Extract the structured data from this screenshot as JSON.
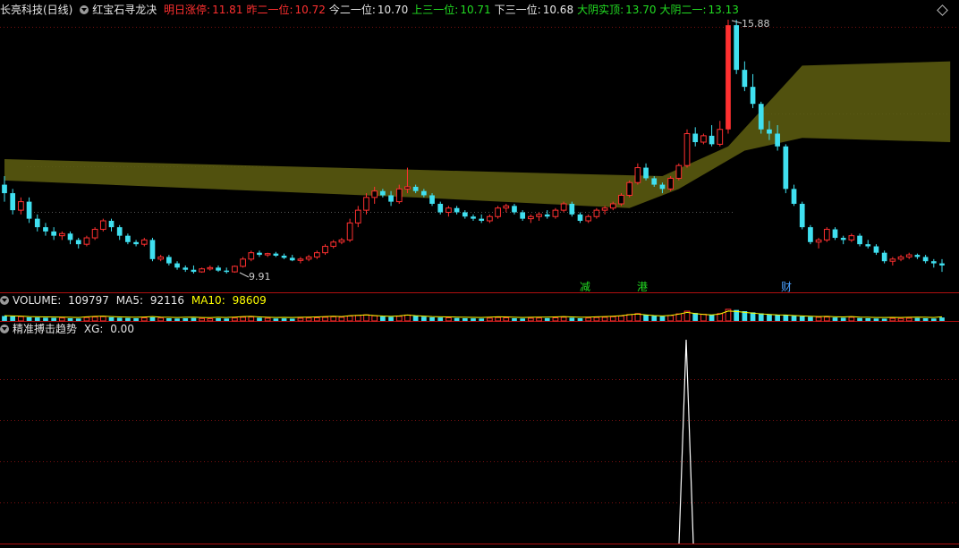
{
  "main_header": {
    "stock": "长亮科技(日线)",
    "indicator": "红宝石寻龙决",
    "items": [
      {
        "label": "明日涨停:",
        "value": "11.81",
        "color": "#ff3030",
        "vcolor": "#ff3030"
      },
      {
        "label": "昨二一位:",
        "value": "10.72",
        "color": "#ff3030",
        "vcolor": "#ff3030"
      },
      {
        "label": "今二一位:",
        "value": "10.70",
        "color": "#e6e6e6",
        "vcolor": "#e6e6e6"
      },
      {
        "label": "上三一位:",
        "value": "10.71",
        "color": "#22dd22",
        "vcolor": "#22dd22"
      },
      {
        "label": "下三一位:",
        "value": "10.68",
        "color": "#e6e6e6",
        "vcolor": "#e6e6e6"
      },
      {
        "label": "大阴实顶:",
        "value": "13.70",
        "color": "#22dd22",
        "vcolor": "#22dd22"
      },
      {
        "label": "大阴二一:",
        "value": "13.13",
        "color": "#22dd22",
        "vcolor": "#22dd22"
      }
    ]
  },
  "volume_header": {
    "label": "VOLUME:",
    "value": "109797",
    "ma5_label": "MA5:",
    "ma5": "92116",
    "ma10_label": "MA10:",
    "ma10": "98609"
  },
  "sub_header": {
    "label": "精准搏击趋势",
    "xg_label": "XG:",
    "xg": "0.00"
  },
  "annotations": {
    "high": "15.88",
    "low": "9.91"
  },
  "markers": [
    {
      "text": "减",
      "color": "#22dd22"
    },
    {
      "text": "港",
      "color": "#22dd22"
    },
    {
      "text": "财",
      "color": "#4aa0ff"
    }
  ],
  "colors": {
    "up": "#ff3030",
    "down": "#40e0f0",
    "band": "#5a5a10",
    "signal": "#ffffff"
  },
  "chart_data": {
    "type": "candlestick",
    "title": "红宝石寻龙决",
    "price_range": [
      9.91,
      15.88
    ],
    "candles": [
      [
        12.0,
        12.2,
        11.6,
        11.8
      ],
      [
        11.8,
        11.9,
        11.3,
        11.4
      ],
      [
        11.4,
        11.7,
        11.3,
        11.6
      ],
      [
        11.6,
        11.7,
        11.1,
        11.2
      ],
      [
        11.2,
        11.3,
        10.9,
        11.0
      ],
      [
        11.0,
        11.1,
        10.8,
        10.9
      ],
      [
        10.9,
        11.0,
        10.7,
        10.8
      ],
      [
        10.8,
        10.9,
        10.7,
        10.85
      ],
      [
        10.85,
        10.9,
        10.6,
        10.7
      ],
      [
        10.7,
        10.75,
        10.5,
        10.6
      ],
      [
        10.6,
        10.8,
        10.55,
        10.75
      ],
      [
        10.75,
        11.0,
        10.7,
        10.95
      ],
      [
        10.95,
        11.2,
        10.9,
        11.15
      ],
      [
        11.15,
        11.2,
        10.9,
        11.0
      ],
      [
        11.0,
        11.05,
        10.7,
        10.8
      ],
      [
        10.8,
        10.85,
        10.6,
        10.65
      ],
      [
        10.65,
        10.7,
        10.55,
        10.6
      ],
      [
        10.6,
        10.75,
        10.55,
        10.7
      ],
      [
        10.7,
        10.75,
        10.2,
        10.25
      ],
      [
        10.25,
        10.35,
        10.2,
        10.3
      ],
      [
        10.3,
        10.35,
        10.1,
        10.15
      ],
      [
        10.15,
        10.2,
        10.0,
        10.05
      ],
      [
        10.05,
        10.1,
        9.95,
        10.0
      ],
      [
        10.0,
        10.1,
        9.91,
        9.95
      ],
      [
        9.95,
        10.05,
        9.93,
        10.02
      ],
      [
        10.02,
        10.1,
        9.98,
        10.05
      ],
      [
        10.05,
        10.1,
        9.95,
        9.98
      ],
      [
        9.98,
        10.05,
        9.91,
        9.95
      ],
      [
        9.95,
        10.1,
        9.93,
        10.08
      ],
      [
        10.08,
        10.3,
        10.05,
        10.25
      ],
      [
        10.25,
        10.45,
        10.2,
        10.4
      ],
      [
        10.4,
        10.45,
        10.3,
        10.35
      ],
      [
        10.35,
        10.4,
        10.3,
        10.38
      ],
      [
        10.38,
        10.42,
        10.3,
        10.33
      ],
      [
        10.33,
        10.38,
        10.25,
        10.28
      ],
      [
        10.28,
        10.35,
        10.2,
        10.22
      ],
      [
        10.22,
        10.3,
        10.15,
        10.25
      ],
      [
        10.25,
        10.35,
        10.2,
        10.3
      ],
      [
        10.3,
        10.45,
        10.25,
        10.4
      ],
      [
        10.4,
        10.6,
        10.35,
        10.55
      ],
      [
        10.55,
        10.7,
        10.5,
        10.65
      ],
      [
        10.65,
        10.75,
        10.6,
        10.7
      ],
      [
        10.7,
        11.2,
        10.65,
        11.1
      ],
      [
        11.1,
        11.5,
        11.0,
        11.4
      ],
      [
        11.4,
        11.8,
        11.3,
        11.7
      ],
      [
        11.7,
        11.95,
        11.55,
        11.85
      ],
      [
        11.85,
        11.9,
        11.7,
        11.75
      ],
      [
        11.75,
        11.85,
        11.5,
        11.6
      ],
      [
        11.6,
        12.0,
        11.55,
        11.9
      ],
      [
        11.9,
        12.4,
        11.8,
        11.95
      ],
      [
        11.95,
        12.0,
        11.8,
        11.85
      ],
      [
        11.85,
        11.9,
        11.7,
        11.75
      ],
      [
        11.75,
        11.8,
        11.5,
        11.55
      ],
      [
        11.55,
        11.6,
        11.3,
        11.35
      ],
      [
        11.35,
        11.5,
        11.25,
        11.45
      ],
      [
        11.45,
        11.5,
        11.3,
        11.35
      ],
      [
        11.35,
        11.4,
        11.2,
        11.25
      ],
      [
        11.25,
        11.3,
        11.15,
        11.2
      ],
      [
        11.2,
        11.3,
        11.1,
        11.15
      ],
      [
        11.15,
        11.3,
        11.1,
        11.25
      ],
      [
        11.25,
        11.5,
        11.2,
        11.45
      ],
      [
        11.45,
        11.55,
        11.35,
        11.5
      ],
      [
        11.5,
        11.55,
        11.3,
        11.35
      ],
      [
        11.35,
        11.4,
        11.15,
        11.2
      ],
      [
        11.2,
        11.3,
        11.1,
        11.25
      ],
      [
        11.25,
        11.35,
        11.15,
        11.3
      ],
      [
        11.3,
        11.4,
        11.2,
        11.25
      ],
      [
        11.25,
        11.45,
        11.2,
        11.4
      ],
      [
        11.4,
        11.6,
        11.35,
        11.55
      ],
      [
        11.55,
        11.6,
        11.25,
        11.3
      ],
      [
        11.3,
        11.35,
        11.1,
        11.15
      ],
      [
        11.15,
        11.3,
        11.1,
        11.25
      ],
      [
        11.25,
        11.45,
        11.2,
        11.4
      ],
      [
        11.4,
        11.5,
        11.3,
        11.45
      ],
      [
        11.45,
        11.6,
        11.4,
        11.55
      ],
      [
        11.55,
        11.8,
        11.5,
        11.75
      ],
      [
        11.75,
        12.1,
        11.7,
        12.05
      ],
      [
        12.05,
        12.5,
        12.0,
        12.4
      ],
      [
        12.4,
        12.5,
        12.1,
        12.15
      ],
      [
        12.15,
        12.2,
        11.95,
        12.0
      ],
      [
        12.0,
        12.05,
        11.8,
        11.9
      ],
      [
        11.9,
        12.2,
        11.85,
        12.15
      ],
      [
        12.15,
        12.5,
        12.1,
        12.45
      ],
      [
        12.45,
        13.3,
        12.4,
        13.2
      ],
      [
        13.2,
        13.35,
        12.9,
        13.0
      ],
      [
        13.0,
        13.2,
        12.95,
        13.15
      ],
      [
        13.15,
        13.4,
        12.9,
        12.95
      ],
      [
        12.95,
        13.5,
        12.9,
        13.3
      ],
      [
        13.3,
        15.88,
        13.2,
        15.75
      ],
      [
        15.75,
        15.88,
        14.6,
        14.7
      ],
      [
        14.7,
        14.9,
        14.2,
        14.3
      ],
      [
        14.3,
        14.6,
        13.8,
        13.9
      ],
      [
        13.9,
        13.95,
        13.2,
        13.3
      ],
      [
        13.3,
        13.5,
        13.05,
        13.2
      ],
      [
        13.2,
        13.4,
        12.8,
        12.9
      ],
      [
        12.9,
        12.95,
        11.8,
        11.9
      ],
      [
        11.9,
        12.0,
        11.5,
        11.55
      ],
      [
        11.55,
        11.6,
        10.95,
        11.0
      ],
      [
        11.0,
        11.05,
        10.6,
        10.65
      ],
      [
        10.65,
        10.75,
        10.5,
        10.7
      ],
      [
        10.7,
        11.0,
        10.65,
        10.95
      ],
      [
        10.95,
        11.0,
        10.7,
        10.75
      ],
      [
        10.75,
        10.8,
        10.6,
        10.7
      ],
      [
        10.7,
        10.85,
        10.65,
        10.8
      ],
      [
        10.8,
        10.85,
        10.55,
        10.6
      ],
      [
        10.6,
        10.7,
        10.5,
        10.55
      ],
      [
        10.55,
        10.6,
        10.35,
        10.4
      ],
      [
        10.4,
        10.45,
        10.15,
        10.2
      ],
      [
        10.2,
        10.3,
        10.1,
        10.25
      ],
      [
        10.25,
        10.35,
        10.2,
        10.3
      ],
      [
        10.3,
        10.4,
        10.25,
        10.35
      ],
      [
        10.35,
        10.38,
        10.25,
        10.3
      ],
      [
        10.3,
        10.35,
        10.15,
        10.2
      ],
      [
        10.2,
        10.25,
        10.05,
        10.15
      ],
      [
        10.15,
        10.25,
        9.95,
        10.1
      ]
    ],
    "volume": [
      40,
      38,
      35,
      30,
      28,
      26,
      25,
      24,
      22,
      20,
      28,
      32,
      35,
      30,
      26,
      24,
      22,
      25,
      30,
      24,
      22,
      20,
      22,
      24,
      20,
      18,
      22,
      20,
      24,
      30,
      32,
      26,
      22,
      20,
      21,
      19,
      22,
      24,
      26,
      30,
      34,
      30,
      40,
      45,
      50,
      42,
      36,
      33,
      38,
      48,
      40,
      35,
      30,
      28,
      26,
      24,
      22,
      21,
      20,
      23,
      28,
      26,
      22,
      20,
      22,
      24,
      23,
      26,
      30,
      26,
      22,
      24,
      28,
      30,
      34,
      40,
      52,
      60,
      50,
      42,
      38,
      44,
      58,
      80,
      65,
      55,
      50,
      60,
      95,
      90,
      80,
      70,
      62,
      55,
      50,
      48,
      42,
      38,
      34,
      30,
      32,
      28,
      26,
      30,
      24,
      22,
      20,
      19,
      21,
      20,
      22,
      24,
      22,
      20,
      28
    ],
    "xg_signal_index": 83,
    "band": {
      "upper": [
        [
          0,
          12.6
        ],
        [
          50,
          12.35
        ],
        [
          80,
          12.2
        ],
        [
          88,
          12.9
        ],
        [
          97,
          14.8
        ],
        [
          115,
          14.9
        ]
      ],
      "lower": [
        [
          0,
          12.1
        ],
        [
          50,
          11.7
        ],
        [
          76,
          11.45
        ],
        [
          82,
          11.9
        ],
        [
          90,
          12.8
        ],
        [
          97,
          13.1
        ],
        [
          115,
          13.0
        ]
      ]
    }
  }
}
